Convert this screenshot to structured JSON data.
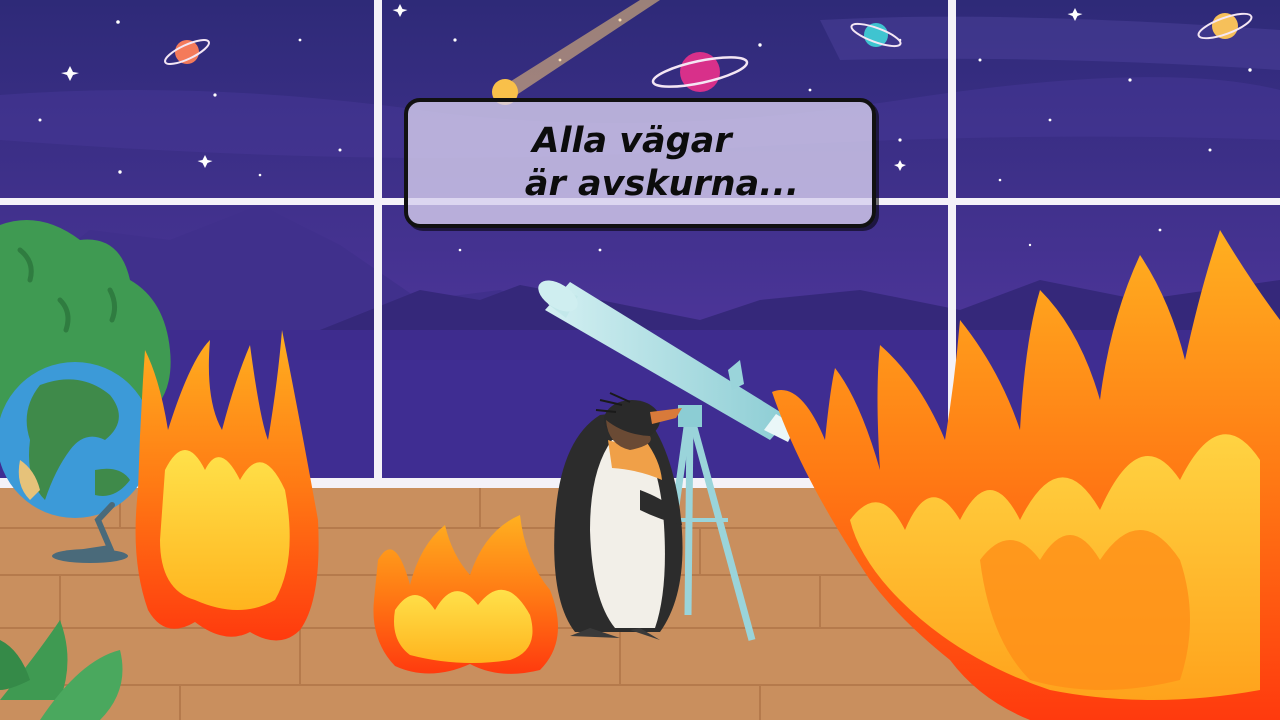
{
  "dialogue": {
    "lines": [
      "Alla vägar",
      "är avskurna..."
    ]
  },
  "colors": {
    "sky_top": "#2e2a78",
    "sky_bottom": "#5a3aa8",
    "mountains": "#3d2d88",
    "window_frame": "#f4f2f8",
    "floor": "#c98f5e",
    "floor_lines": "#b57a4c",
    "telescope": "#a9dde2",
    "fire_outer": "#ff4d12",
    "fire_inner": "#ffd21a",
    "text_box_bg": "#d6ceee",
    "text_box_border": "#111111"
  },
  "icons": [
    "star-icon",
    "planet-icon",
    "comet-icon",
    "globe-icon",
    "telescope-icon",
    "penguin-icon",
    "fire-icon",
    "plant-icon"
  ]
}
